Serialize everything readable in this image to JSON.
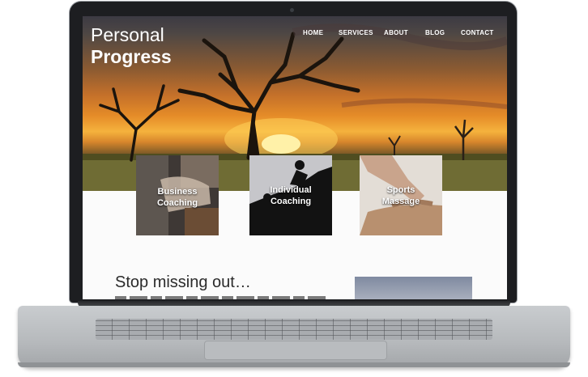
{
  "site": {
    "brand_line1": "Personal",
    "brand_line2": "Progress"
  },
  "nav": {
    "items": [
      "HOME",
      "SERVICES",
      "ABOUT",
      "BLOG",
      "CONTACT"
    ]
  },
  "services": [
    {
      "line1": "Business",
      "line2": "Coaching"
    },
    {
      "line1": "Individual",
      "line2": "Coaching"
    },
    {
      "line1": "Sports",
      "line2": "Massage"
    }
  ],
  "content": {
    "headline": "Stop missing out…"
  },
  "colors": {
    "nav_text": "#ffffff",
    "headline_text": "#2b2b2b",
    "laptop_bezel": "#1d1e21",
    "laptop_body": "#c9cccf"
  }
}
